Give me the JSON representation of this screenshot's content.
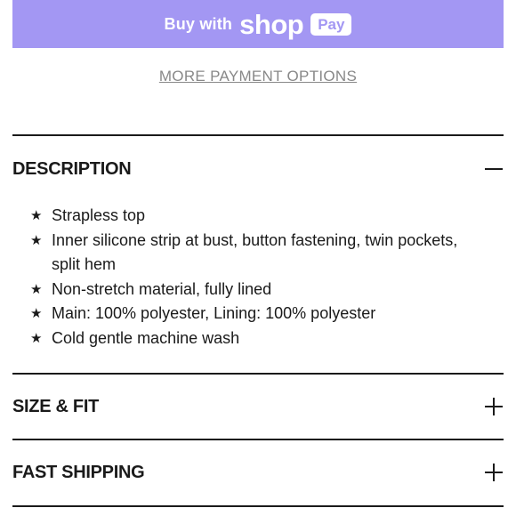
{
  "payment": {
    "shop_button": {
      "prefix": "Buy with",
      "brand": "shop",
      "badge": "Pay",
      "color": "#a397f3"
    },
    "more_options_label": "MORE PAYMENT OPTIONS"
  },
  "accordion": {
    "description": {
      "title": "DESCRIPTION",
      "expanded": true,
      "toggle_icon": "minus-icon",
      "bullet_icon": "star-icon",
      "bullets": [
        "Strapless top",
        "Inner silicone strip at bust, button fastening, twin pockets, split hem",
        "Non-stretch material, fully lined",
        "Main: 100% polyester, Lining: 100% polyester",
        "Cold gentle machine wash"
      ]
    },
    "size_fit": {
      "title": "SIZE & FIT",
      "expanded": false,
      "toggle_icon": "plus-icon"
    },
    "fast_shipping": {
      "title": "FAST SHIPPING",
      "expanded": false,
      "toggle_icon": "plus-icon"
    }
  }
}
